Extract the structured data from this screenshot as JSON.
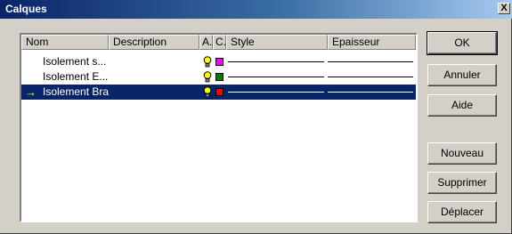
{
  "window": {
    "title": "Calques",
    "close_glyph": "X"
  },
  "columns": [
    "Nom",
    "Description",
    "A.",
    "C.",
    "Style",
    "Epaisseur"
  ],
  "rows": [
    {
      "name": "Isolement s...",
      "color": "#ff00ff",
      "selected": false
    },
    {
      "name": "Isolement E...",
      "color": "#008000",
      "selected": false
    },
    {
      "name": "Isolement Bra",
      "color": "#ff0000",
      "selected": true,
      "current_marker": "→"
    }
  ],
  "buttons": {
    "ok": "OK",
    "cancel": "Annuler",
    "help": "Aide",
    "new": "Nouveau",
    "delete": "Supprimer",
    "move": "Déplacer"
  },
  "icons": {
    "active": "lightbulb-icon",
    "current": "arrow-right-icon"
  }
}
